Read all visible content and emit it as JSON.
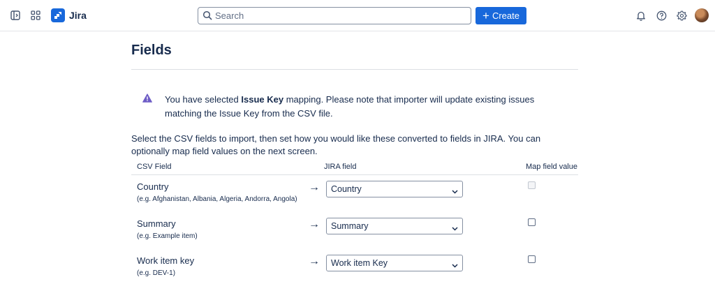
{
  "topbar": {
    "app_name": "Jira",
    "search_placeholder": "Search",
    "create_label": "Create"
  },
  "page": {
    "title": "Fields",
    "warning": {
      "prefix": "You have selected ",
      "bold": "Issue Key",
      "suffix": " mapping. Please note that importer will update existing issues matching the Issue Key from the CSV file."
    },
    "intro": "Select the CSV fields to import, then set how you would like these converted to fields in JIRA. You can optionally map field values on the next screen."
  },
  "table": {
    "headers": {
      "csv_field": "CSV Field",
      "jira_field": "JIRA field",
      "map_value": "Map field value"
    },
    "rows": [
      {
        "name": "Country",
        "example": "(e.g.  Afghanistan, Albania, Algeria, Andorra, Angola)",
        "jira_field": "Country",
        "map_disabled": true
      },
      {
        "name": "Summary",
        "example": "(e.g.  Example item)",
        "jira_field": "Summary",
        "map_disabled": false
      },
      {
        "name": "Work item key",
        "example": "(e.g.  DEV-1)",
        "jira_field": "Work item Key",
        "map_disabled": false
      }
    ]
  },
  "colors": {
    "primary": "#1868db",
    "warning_icon": "#6e5dc6",
    "text": "#172b4d"
  }
}
